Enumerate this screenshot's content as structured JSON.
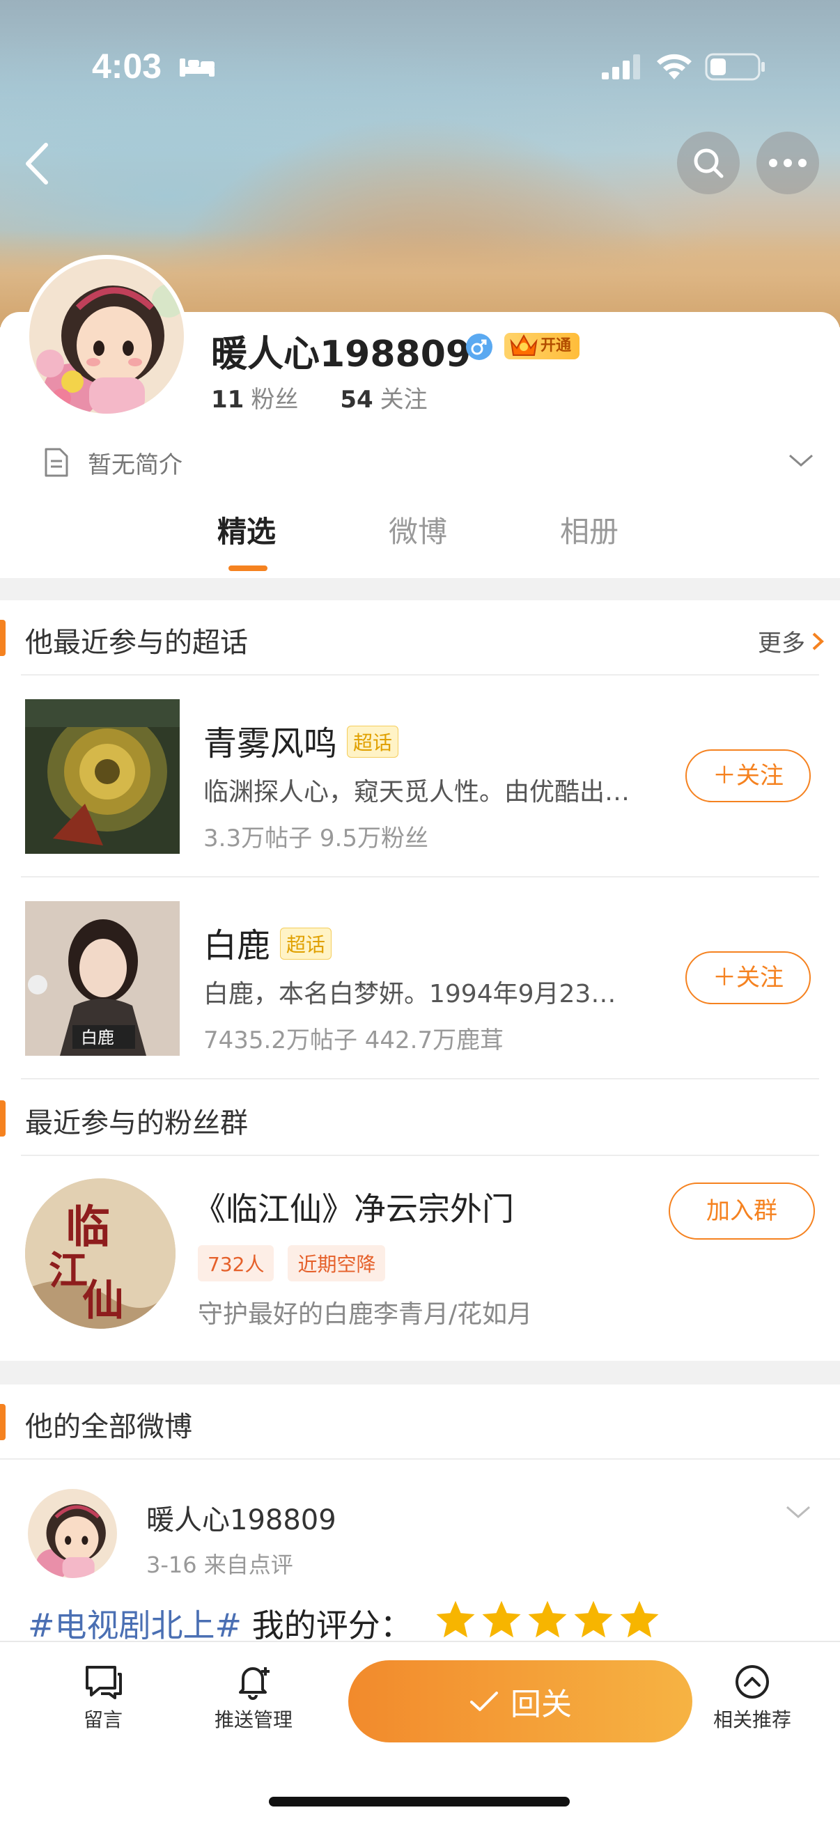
{
  "status_bar": {
    "time": "4:03"
  },
  "profile": {
    "username": "暖人心198809",
    "vip_label": "开通",
    "fans_count": "11",
    "fans_label": "粉丝",
    "following_count": "54",
    "following_label": "关注",
    "bio": "暂无简介"
  },
  "tabs": [
    {
      "label": "精选",
      "active": true
    },
    {
      "label": "微博",
      "active": false
    },
    {
      "label": "相册",
      "active": false
    }
  ],
  "supertopics_section": {
    "title": "他最近参与的超话",
    "more": "更多",
    "items": [
      {
        "name": "青雾风鸣",
        "tag": "超话",
        "desc": "临渊探人心，窥天觅人性。由优酷出…",
        "stats": "3.3万帖子 9.5万粉丝",
        "button": "＋关注"
      },
      {
        "name": "白鹿",
        "tag": "超话",
        "desc": "白鹿，本名白梦妍。1994年9月23…",
        "stats": "7435.2万帖子 442.7万鹿茸",
        "button": "＋关注"
      }
    ]
  },
  "fan_groups_section": {
    "title": "最近参与的粉丝群",
    "group": {
      "name": "《临江仙》净云宗外门",
      "tags": [
        "732人",
        "近期空降"
      ],
      "desc": "守护最好的白鹿李青月/花如月",
      "button": "加入群",
      "avatar_text": "临江仙"
    }
  },
  "posts_section": {
    "title": "他的全部微博",
    "post": {
      "user": "暖人心198809",
      "meta": "3-16  来自点评",
      "hashtag": "#电视剧北上#",
      "text": " 我的评分：",
      "rating": 5
    }
  },
  "bottom_bar": {
    "message": "留言",
    "push": "推送管理",
    "followed": "回关",
    "recommend": "相关推荐"
  },
  "colors": {
    "accent": "#f58220",
    "hashtag": "#4a6fb3"
  }
}
